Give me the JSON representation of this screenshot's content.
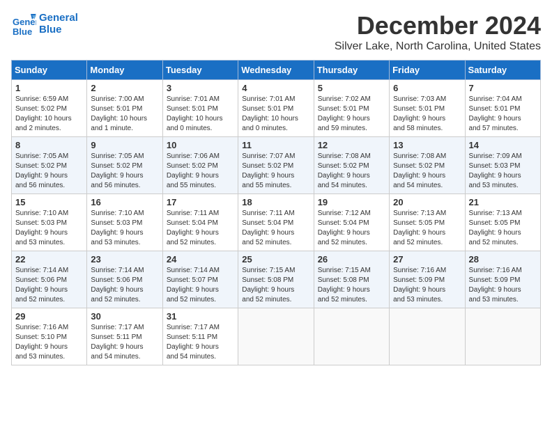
{
  "header": {
    "logo_line1": "General",
    "logo_line2": "Blue",
    "month": "December 2024",
    "location": "Silver Lake, North Carolina, United States"
  },
  "days_of_week": [
    "Sunday",
    "Monday",
    "Tuesday",
    "Wednesday",
    "Thursday",
    "Friday",
    "Saturday"
  ],
  "weeks": [
    [
      {
        "day": "1",
        "info": "Sunrise: 6:59 AM\nSunset: 5:02 PM\nDaylight: 10 hours\nand 2 minutes."
      },
      {
        "day": "2",
        "info": "Sunrise: 7:00 AM\nSunset: 5:01 PM\nDaylight: 10 hours\nand 1 minute."
      },
      {
        "day": "3",
        "info": "Sunrise: 7:01 AM\nSunset: 5:01 PM\nDaylight: 10 hours\nand 0 minutes."
      },
      {
        "day": "4",
        "info": "Sunrise: 7:01 AM\nSunset: 5:01 PM\nDaylight: 10 hours\nand 0 minutes."
      },
      {
        "day": "5",
        "info": "Sunrise: 7:02 AM\nSunset: 5:01 PM\nDaylight: 9 hours\nand 59 minutes."
      },
      {
        "day": "6",
        "info": "Sunrise: 7:03 AM\nSunset: 5:01 PM\nDaylight: 9 hours\nand 58 minutes."
      },
      {
        "day": "7",
        "info": "Sunrise: 7:04 AM\nSunset: 5:01 PM\nDaylight: 9 hours\nand 57 minutes."
      }
    ],
    [
      {
        "day": "8",
        "info": "Sunrise: 7:05 AM\nSunset: 5:02 PM\nDaylight: 9 hours\nand 56 minutes."
      },
      {
        "day": "9",
        "info": "Sunrise: 7:05 AM\nSunset: 5:02 PM\nDaylight: 9 hours\nand 56 minutes."
      },
      {
        "day": "10",
        "info": "Sunrise: 7:06 AM\nSunset: 5:02 PM\nDaylight: 9 hours\nand 55 minutes."
      },
      {
        "day": "11",
        "info": "Sunrise: 7:07 AM\nSunset: 5:02 PM\nDaylight: 9 hours\nand 55 minutes."
      },
      {
        "day": "12",
        "info": "Sunrise: 7:08 AM\nSunset: 5:02 PM\nDaylight: 9 hours\nand 54 minutes."
      },
      {
        "day": "13",
        "info": "Sunrise: 7:08 AM\nSunset: 5:02 PM\nDaylight: 9 hours\nand 54 minutes."
      },
      {
        "day": "14",
        "info": "Sunrise: 7:09 AM\nSunset: 5:03 PM\nDaylight: 9 hours\nand 53 minutes."
      }
    ],
    [
      {
        "day": "15",
        "info": "Sunrise: 7:10 AM\nSunset: 5:03 PM\nDaylight: 9 hours\nand 53 minutes."
      },
      {
        "day": "16",
        "info": "Sunrise: 7:10 AM\nSunset: 5:03 PM\nDaylight: 9 hours\nand 53 minutes."
      },
      {
        "day": "17",
        "info": "Sunrise: 7:11 AM\nSunset: 5:04 PM\nDaylight: 9 hours\nand 52 minutes."
      },
      {
        "day": "18",
        "info": "Sunrise: 7:11 AM\nSunset: 5:04 PM\nDaylight: 9 hours\nand 52 minutes."
      },
      {
        "day": "19",
        "info": "Sunrise: 7:12 AM\nSunset: 5:04 PM\nDaylight: 9 hours\nand 52 minutes."
      },
      {
        "day": "20",
        "info": "Sunrise: 7:13 AM\nSunset: 5:05 PM\nDaylight: 9 hours\nand 52 minutes."
      },
      {
        "day": "21",
        "info": "Sunrise: 7:13 AM\nSunset: 5:05 PM\nDaylight: 9 hours\nand 52 minutes."
      }
    ],
    [
      {
        "day": "22",
        "info": "Sunrise: 7:14 AM\nSunset: 5:06 PM\nDaylight: 9 hours\nand 52 minutes."
      },
      {
        "day": "23",
        "info": "Sunrise: 7:14 AM\nSunset: 5:06 PM\nDaylight: 9 hours\nand 52 minutes."
      },
      {
        "day": "24",
        "info": "Sunrise: 7:14 AM\nSunset: 5:07 PM\nDaylight: 9 hours\nand 52 minutes."
      },
      {
        "day": "25",
        "info": "Sunrise: 7:15 AM\nSunset: 5:08 PM\nDaylight: 9 hours\nand 52 minutes."
      },
      {
        "day": "26",
        "info": "Sunrise: 7:15 AM\nSunset: 5:08 PM\nDaylight: 9 hours\nand 52 minutes."
      },
      {
        "day": "27",
        "info": "Sunrise: 7:16 AM\nSunset: 5:09 PM\nDaylight: 9 hours\nand 53 minutes."
      },
      {
        "day": "28",
        "info": "Sunrise: 7:16 AM\nSunset: 5:09 PM\nDaylight: 9 hours\nand 53 minutes."
      }
    ],
    [
      {
        "day": "29",
        "info": "Sunrise: 7:16 AM\nSunset: 5:10 PM\nDaylight: 9 hours\nand 53 minutes."
      },
      {
        "day": "30",
        "info": "Sunrise: 7:17 AM\nSunset: 5:11 PM\nDaylight: 9 hours\nand 54 minutes."
      },
      {
        "day": "31",
        "info": "Sunrise: 7:17 AM\nSunset: 5:11 PM\nDaylight: 9 hours\nand 54 minutes."
      },
      {
        "day": "",
        "info": ""
      },
      {
        "day": "",
        "info": ""
      },
      {
        "day": "",
        "info": ""
      },
      {
        "day": "",
        "info": ""
      }
    ]
  ]
}
